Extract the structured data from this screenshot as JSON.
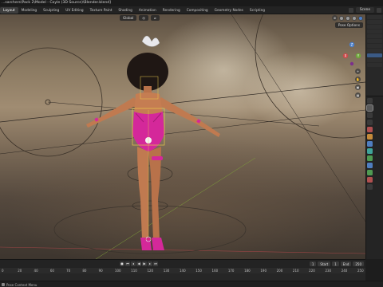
{
  "window": {
    "title": "...sarchers\\Pack 2\\Model - Coyle (3D Source)\\Blender.blend]"
  },
  "workspace_tabs": [
    {
      "label": "Layout",
      "active": true
    },
    {
      "label": "Modeling",
      "active": false
    },
    {
      "label": "Sculpting",
      "active": false
    },
    {
      "label": "UV Editing",
      "active": false
    },
    {
      "label": "Texture Paint",
      "active": false
    },
    {
      "label": "Shading",
      "active": false
    },
    {
      "label": "Animation",
      "active": false
    },
    {
      "label": "Rendering",
      "active": false
    },
    {
      "label": "Compositing",
      "active": false
    },
    {
      "label": "Geometry Nodes",
      "active": false
    },
    {
      "label": "Scripting",
      "active": false
    }
  ],
  "scene": {
    "name": "Scene"
  },
  "viewport": {
    "transform_orientation": "Global",
    "pose_options": "Pose Options",
    "axis_labels": {
      "x": "X",
      "y": "Y",
      "z": "Z"
    }
  },
  "timeline": {
    "current_frame": "1",
    "start_label": "Start",
    "start_value": "1",
    "end_label": "End",
    "end_value": "250",
    "ticks": [
      "0",
      "20",
      "40",
      "60",
      "70",
      "80",
      "90",
      "100",
      "110",
      "120",
      "130",
      "140",
      "150",
      "160",
      "170",
      "180",
      "190",
      "200",
      "210",
      "220",
      "230",
      "240",
      "250"
    ]
  },
  "status": {
    "text": "Pose Context Menu"
  },
  "colors": {
    "accent": "#4a7ec9",
    "bone_outline": "#e8c84a",
    "outfit": "#d4289a",
    "skin": "#c07a50"
  }
}
